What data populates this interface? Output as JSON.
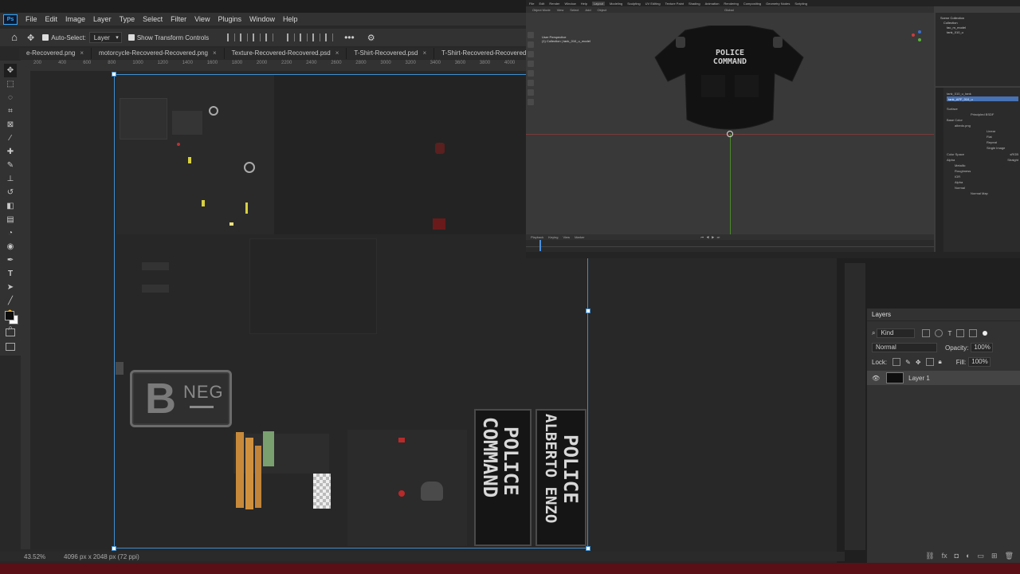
{
  "photoshop": {
    "logo": "Ps",
    "menu": [
      "File",
      "Edit",
      "Image",
      "Layer",
      "Type",
      "Select",
      "Filter",
      "View",
      "Plugins",
      "Window",
      "Help"
    ],
    "options": {
      "auto_select_label": "Auto-Select:",
      "auto_select_target": "Layer",
      "show_transform_label": "Show Transform Controls"
    },
    "tabs": [
      "e-Recovered.png",
      "motorcycle-Recovered-Recovered.png",
      "Texture-Recovered-Recovered.psd",
      "T-Shirt-Recovered.psd",
      "T-Shirt-Recovered-Recovered.psd"
    ],
    "ruler_ticks": [
      "200",
      "400",
      "600",
      "800",
      "1000",
      "1200",
      "1400",
      "1600",
      "1800",
      "2000",
      "2200",
      "2400",
      "2600",
      "2800",
      "3000",
      "3200",
      "3400",
      "3600",
      "3800",
      "4000"
    ],
    "status": {
      "zoom": "43.52%",
      "doc_info": "4096 px x 2048 px (72 ppi)"
    },
    "canvas": {
      "patch_badge": {
        "letter": "B",
        "text": "NEG"
      },
      "patch_left": {
        "line1": "POLICE",
        "line2": "COMMAND"
      },
      "patch_right": {
        "line1": "POLICE",
        "line2": "ALBERTO ENZO"
      }
    },
    "layers_panel": {
      "title": "Layers",
      "filter_kind": "Kind",
      "blend_mode": "Normal",
      "opacity_label": "Opacity:",
      "opacity_value": "100%",
      "lock_label": "Lock:",
      "fill_label": "Fill:",
      "fill_value": "100%",
      "layers": [
        {
          "name": "Layer 1",
          "visible": true
        }
      ]
    }
  },
  "blender": {
    "top_menu": [
      "File",
      "Edit",
      "Render",
      "Window",
      "Help",
      "Layout",
      "Modeling",
      "Sculpting",
      "UV Editing",
      "Texture Paint",
      "Shading",
      "Animation",
      "Rendering",
      "Compositing",
      "Geometry Nodes",
      "Scripting"
    ],
    "viewport_header": [
      "Object Mode",
      "View",
      "Select",
      "Add",
      "Object",
      "Global"
    ],
    "viewport_overlay": [
      "User Perspective",
      "(1) Collection | tank_010_u_model"
    ],
    "shirt_text": {
      "line1": "POLICE",
      "line2": "COMMAND"
    },
    "timeline": {
      "items": [
        "Playback",
        "Keying",
        "View",
        "Marker"
      ]
    },
    "outliner": {
      "title": "Scene Collection",
      "items": [
        "Collection",
        "tac_m_model",
        "tank_010_u"
      ]
    },
    "properties": {
      "items": [
        "tank_010_u_tank",
        "tank_AFF_010_u",
        "Surface",
        "Principled BSDF",
        "Base Color",
        "albedo.png",
        "Linear",
        "Flat",
        "Repeat",
        "Single Image",
        "Color Space",
        "sRGB",
        "Alpha",
        "Straight",
        "Metallic",
        "Roughness",
        "IOR",
        "Alpha",
        "Normal",
        "Normal Map"
      ]
    }
  },
  "colors": {
    "accent": "#3e8ed0",
    "taskbar": "#5a0f16"
  }
}
